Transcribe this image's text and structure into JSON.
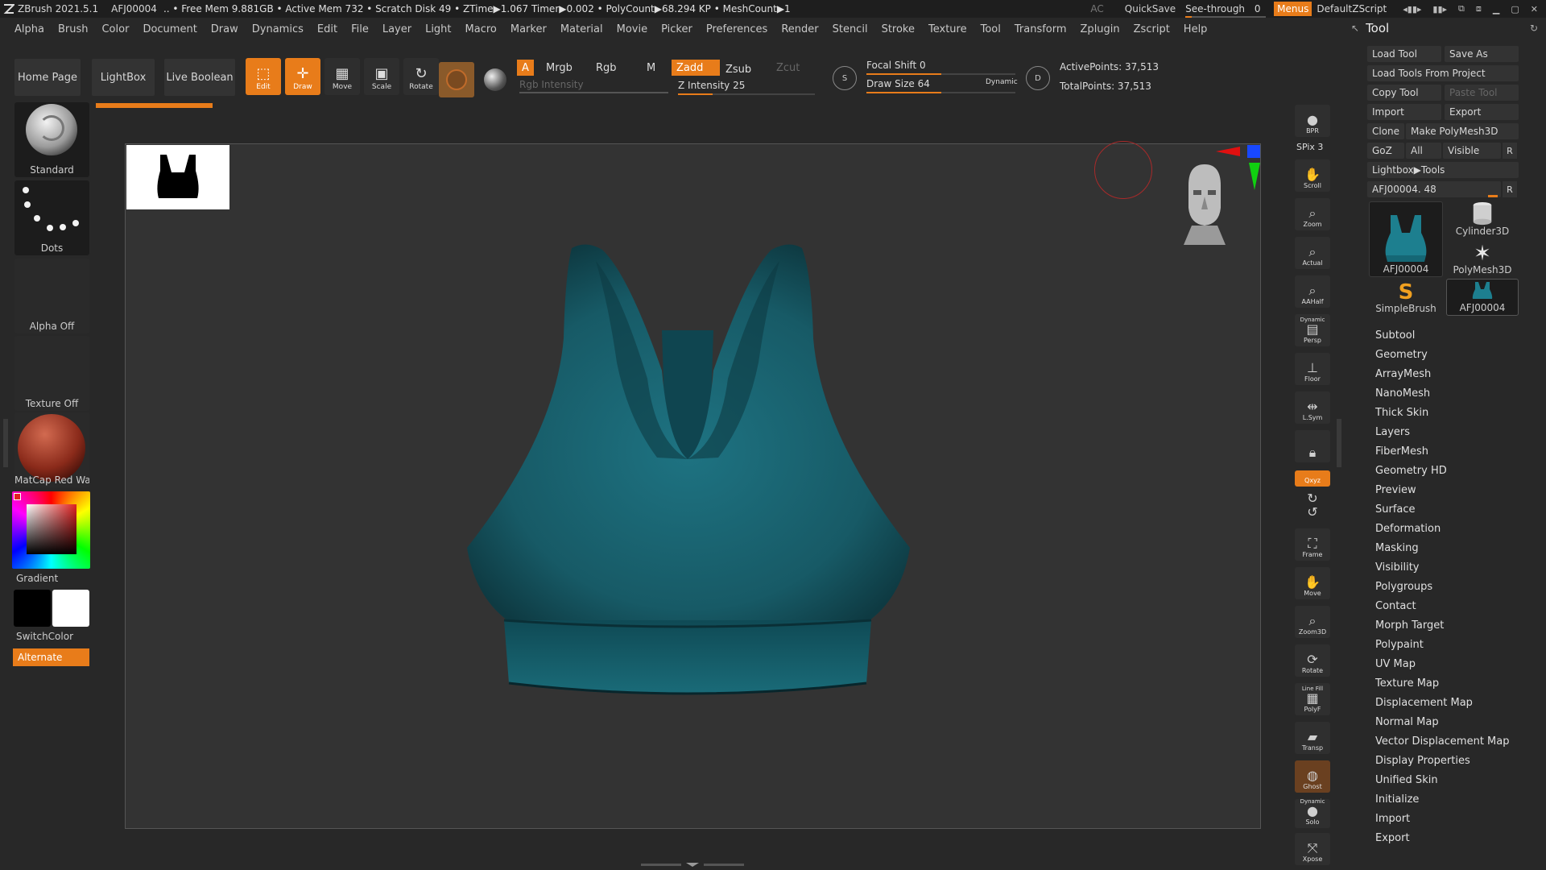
{
  "titlebar": {
    "app_name": "ZBrush 2021.5.1",
    "tool_name": "AFJ00004",
    "stats": ".. • Free Mem 9.881GB • Active Mem 732 • Scratch Disk 49 • ZTime▶1.067 Timer▶0.002 • PolyCount▶68.294 KP • MeshCount▶1",
    "ac": "AC",
    "quicksave": "QuickSave",
    "seethrough_label": "See-through",
    "seethrough_value": "0",
    "menus": "Menus",
    "script": "DefaultZScript"
  },
  "menubar": {
    "items": [
      "Alpha",
      "Brush",
      "Color",
      "Document",
      "Draw",
      "Dynamics",
      "Edit",
      "File",
      "Layer",
      "Light",
      "Macro",
      "Marker",
      "Material",
      "Movie",
      "Picker",
      "Preferences",
      "Render",
      "Stencil",
      "Stroke",
      "Texture",
      "Tool",
      "Transform",
      "Zplugin",
      "Zscript",
      "Help"
    ]
  },
  "toolbar": {
    "home_page": "Home Page",
    "lightbox": "LightBox",
    "live_boolean": "Live Boolean",
    "edit": "Edit",
    "draw": "Draw",
    "move": "Move",
    "scale": "Scale",
    "rotate": "Rotate",
    "a": "A",
    "mrgb": "Mrgb",
    "rgb": "Rgb",
    "m": "M",
    "zadd": "Zadd",
    "zsub": "Zsub",
    "zcut": "Zcut",
    "rgb_intensity": "Rgb Intensity",
    "z_intensity": "Z Intensity 25",
    "focal_shift": "Focal Shift 0",
    "draw_size": "Draw Size 64",
    "dynamic": "Dynamic",
    "active_points": "ActivePoints: 37,513",
    "total_points": "TotalPoints: 37,513",
    "z_intensity_level": 0.25,
    "focal_shift_level": 0.5,
    "draw_size_level": 0.5
  },
  "left_shelf": {
    "brush": "Standard",
    "stroke": "Dots",
    "alpha": "Alpha Off",
    "texture": "Texture Off",
    "material": "MatCap Red Wax",
    "gradient": "Gradient",
    "switchcolor": "SwitchColor",
    "alternate": "Alternate"
  },
  "right_bar": {
    "bpr": "BPR",
    "spix": "SPix 3",
    "scroll": "Scroll",
    "zoom": "Zoom",
    "actual": "Actual",
    "aahalf": "AAHalf",
    "dynamic": "Dynamic",
    "persp": "Persp",
    "floor": "Floor",
    "lsym": "L.Sym",
    "xyz": "Qxyz",
    "frame": "Frame",
    "move": "Move",
    "zoom3d": "Zoom3D",
    "rotate": "Rotate",
    "linefill": "Line Fill",
    "polyf": "PolyF",
    "transp": "Transp",
    "ghost": "Ghost",
    "solo": "Solo",
    "xpose": "Xpose"
  },
  "tool_panel": {
    "title": "Tool",
    "load_tool": "Load Tool",
    "save_as": "Save As",
    "load_tools_from_project": "Load Tools From Project",
    "copy_tool": "Copy Tool",
    "paste_tool": "Paste Tool",
    "import": "Import",
    "export": "Export",
    "clone": "Clone",
    "make_polymesh": "Make PolyMesh3D",
    "goz": "GoZ",
    "all": "All",
    "visible": "Visible",
    "r": "R",
    "lightbox_tools": "Lightbox▶Tools",
    "current_tool_slider": "AFJ00004. 48",
    "thumbs": [
      "AFJ00004",
      "Cylinder3D",
      "PolyMesh3D",
      "SimpleBrush",
      "AFJ00004"
    ],
    "list": [
      "Subtool",
      "Geometry",
      "ArrayMesh",
      "NanoMesh",
      "Thick Skin",
      "Layers",
      "FiberMesh",
      "Geometry HD",
      "Preview",
      "Surface",
      "Deformation",
      "Masking",
      "Visibility",
      "Polygroups",
      "Contact",
      "Morph Target",
      "Polypaint",
      "UV Map",
      "Texture Map",
      "Displacement Map",
      "Normal Map",
      "Vector Displacement Map",
      "Display Properties",
      "Unified Skin",
      "Initialize",
      "Import",
      "Export"
    ]
  },
  "colors": {
    "accent": "#e87c1a",
    "garment": "#1b6470"
  }
}
